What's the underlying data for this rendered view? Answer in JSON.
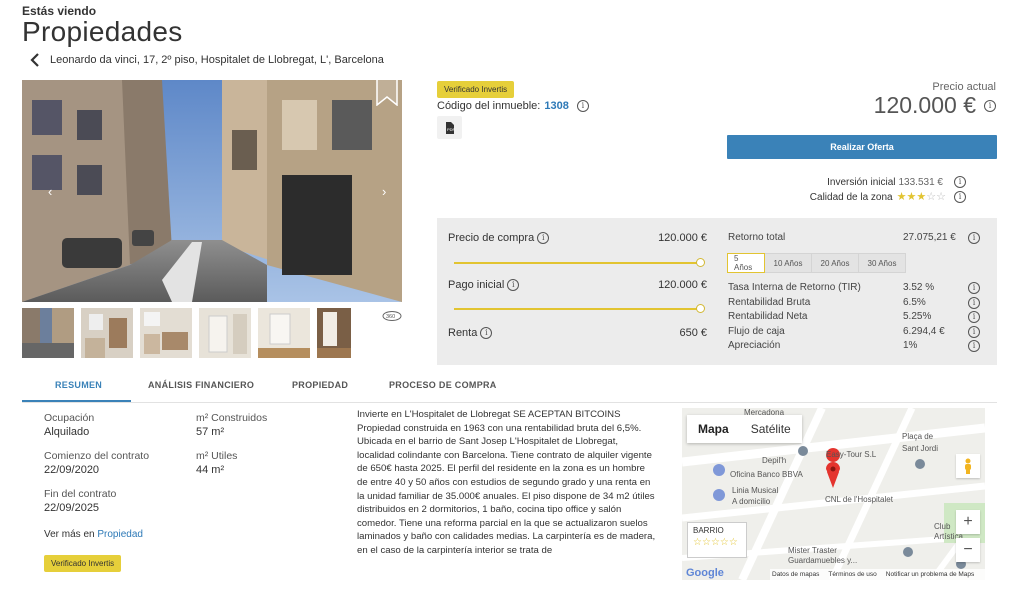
{
  "header": {
    "eyebrow": "Estás viendo",
    "title": "Propiedades",
    "address": "Leonardo da vinci, 17, 2º piso, Hospitalet de Llobregat, L', Barcelona"
  },
  "listing": {
    "verified_badge": "Verificado Invertis",
    "code_label": "Código del inmueble:",
    "code_value": "1308",
    "price_label": "Precio actual",
    "price_value": "120.000 €",
    "offer_button": "Realizar Oferta",
    "investment_label": "Inversión inicial",
    "investment_value": "133.531 €",
    "quality_label": "Calidad de la zona",
    "quality_stars": 3,
    "quality_max": 5
  },
  "calculator": {
    "purchase_label": "Precio de compra",
    "purchase_value": "120.000 €",
    "purchase_slider_pct": 100,
    "down_label": "Pago inicial",
    "down_value": "120.000 €",
    "down_slider_pct": 100,
    "rent_label": "Renta",
    "rent_value": "650 €",
    "total_return_label": "Retorno total",
    "total_return_value": "27.075,21 €",
    "year_tabs": [
      "5 Años",
      "10 Años",
      "20 Años",
      "30 Años"
    ],
    "active_year": 0,
    "metrics": [
      {
        "label": "Tasa Interna de Retorno (TIR)",
        "value": "3.52 %"
      },
      {
        "label": "Rentabilidad Bruta",
        "value": "6.5%"
      },
      {
        "label": "Rentabilidad Neta",
        "value": "5.25%"
      },
      {
        "label": "Flujo de caja",
        "value": "6.294,4 €"
      },
      {
        "label": "Apreciación",
        "value": "1%"
      }
    ]
  },
  "tabs": [
    "RESUMEN",
    "ANÁLISIS FINANCIERO",
    "PROPIEDAD",
    "PROCESO DE COMPRA"
  ],
  "summary": {
    "occupation_label": "Ocupación",
    "occupation_value": "Alquilado",
    "built_label": "m² Construidos",
    "built_value": "57 m²",
    "contract_start_label": "Comienzo del contrato",
    "contract_start_value": "22/09/2020",
    "useful_label": "m² Utiles",
    "useful_value": "44 m²",
    "contract_end_label": "Fin del contrato",
    "contract_end_value": "22/09/2025",
    "more_prefix": "Ver más en",
    "more_link": "Propiedad",
    "verified_badge": "Verificado Invertis",
    "description": "Invierte en L'Hospitalet de Llobregat SE ACEPTAN BITCOINS Propiedad construida en 1963 con una rentabilidad bruta del 6,5%. Ubicada en el barrio de Sant Josep L'Hospitalet de Llobregat, localidad colindante con Barcelona. Tiene contrato de alquiler vigente de 650€ hasta 2025. El perfil del residente en la zona es un hombre de entre 40 y 50 años con estudios de segundo grado y una renta en la unidad familiar de 35.000€ anuales. El piso dispone de 34 m2 útiles distribuidos en 2 dormitorios, 1 baño, cocina tipo office y salón comedor. Tiene una reforma parcial en la que se actualizaron suelos laminados y baño con calidades medias. La carpintería es de madera, en el caso de la carpintería interior se trata de"
  },
  "map": {
    "mode_map": "Mapa",
    "mode_satellite": "Satélite",
    "labels": [
      "Mercadona",
      "Easy-Tour S.L",
      "Plaça de",
      "Sant Jordi",
      "Depil'h",
      "Oficina Banco BBVA",
      "Linia Musical",
      "A domicilio",
      "CNL de l'Hospitalet",
      "Club",
      "Artística",
      "Mister Traster",
      "Guardamuebles y..."
    ],
    "barrio_label": "BARRIO",
    "barrio_stars": 0,
    "zoom_in": "+",
    "zoom_out": "−",
    "google": "Google",
    "footer": [
      "Datos de mapas",
      "Términos de uso",
      "Notificar un problema de Maps"
    ]
  },
  "colors": {
    "accent_blue": "#3a82b8",
    "badge_yellow": "#e6cf3a",
    "panel_gray": "#ececec"
  }
}
